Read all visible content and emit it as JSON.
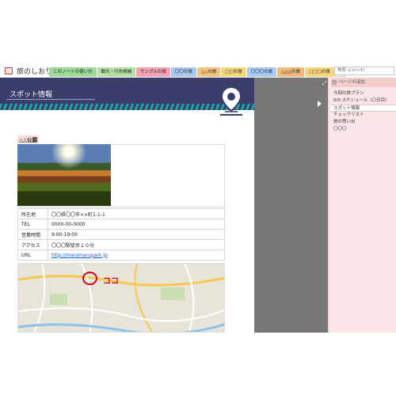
{
  "notebook": {
    "title": "旅のしおり"
  },
  "tabs": [
    {
      "label": "このノートの使い方",
      "color": "#9ed99a"
    },
    {
      "label": "観光・行先候補",
      "color": "#b4e0a6"
    },
    {
      "label": "サンプルの旅",
      "color": "#f3a3b3"
    },
    {
      "label": "〇〇の旅",
      "color": "#a9c8f0"
    },
    {
      "label": "△△の旅",
      "color": "#f5c27a"
    },
    {
      "label": "□□の旅",
      "color": "#f3d77d"
    },
    {
      "label": "〇〇〇の旅",
      "color": "#a7cbf2"
    },
    {
      "label": "△△△の旅",
      "color": "#f2b97a"
    },
    {
      "label": "□□□の旅",
      "color": "#f6d67a"
    },
    {
      "label": "+"
    }
  ],
  "search": {
    "placeholder": "検索 (Ctrl+E)"
  },
  "page": {
    "banner_title": "スポット情報",
    "spot_name": "△△公園",
    "info_rows": [
      {
        "key": "所在地",
        "value": "〇〇県〇〇市××町1-1-1"
      },
      {
        "key": "TEL",
        "value": "0000-00-0000"
      },
      {
        "key": "営業時間",
        "value": "9:00-19:00"
      },
      {
        "key": "アクセス",
        "value": "〇〇〇駅徒歩１０分"
      },
      {
        "key": "URL",
        "value": "http://marumarupark.jp"
      }
    ],
    "map_note": "ココ"
  },
  "side_pane": {
    "add_page": "ページの追加",
    "pages": [
      {
        "label": "今回の旅プラン"
      },
      {
        "label": "0/0 スケジュール（〇日目）"
      },
      {
        "label": "スポット情報",
        "selected": true
      },
      {
        "label": "チェックリスト"
      },
      {
        "label": "旅の思い出"
      },
      {
        "label": "〇〇〇"
      }
    ]
  }
}
